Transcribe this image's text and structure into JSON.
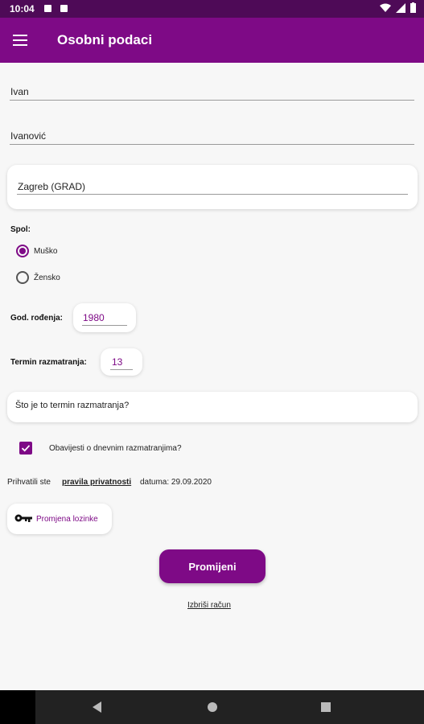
{
  "status_bar": {
    "time": "10:04"
  },
  "app_bar": {
    "title": "Osobni podaci"
  },
  "form": {
    "first_name": "Ivan",
    "last_name": "Ivanović",
    "city": "Zagreb (GRAD)",
    "gender_label": "Spol:",
    "gender_options": [
      "Muško",
      "Žensko"
    ],
    "gender_selected": "Muško",
    "birth_year_label": "God. rođenja:",
    "birth_year": "1980",
    "consideration_term_label": "Termin razmatranja:",
    "consideration_term": "13",
    "consideration_term_help": "Što je to termin razmatranja?",
    "daily_notifications_label": "Obavijesti o dnevnim razmatranjima?",
    "daily_notifications_checked": true,
    "privacy_prefix": "Prihvatili ste",
    "privacy_link": "pravila privatnosti",
    "privacy_date": "datuma: 29.09.2020",
    "change_password_label": "Promjena lozinke",
    "submit_label": "Promijeni",
    "delete_account_label": "Izbriši račun"
  },
  "colors": {
    "primary": "#7e0a86",
    "status_bar": "#4e0a57"
  },
  "icons": {
    "menu": "menu-icon",
    "key": "key-icon",
    "back": "back-icon",
    "home": "home-icon",
    "recents": "recents-icon"
  }
}
